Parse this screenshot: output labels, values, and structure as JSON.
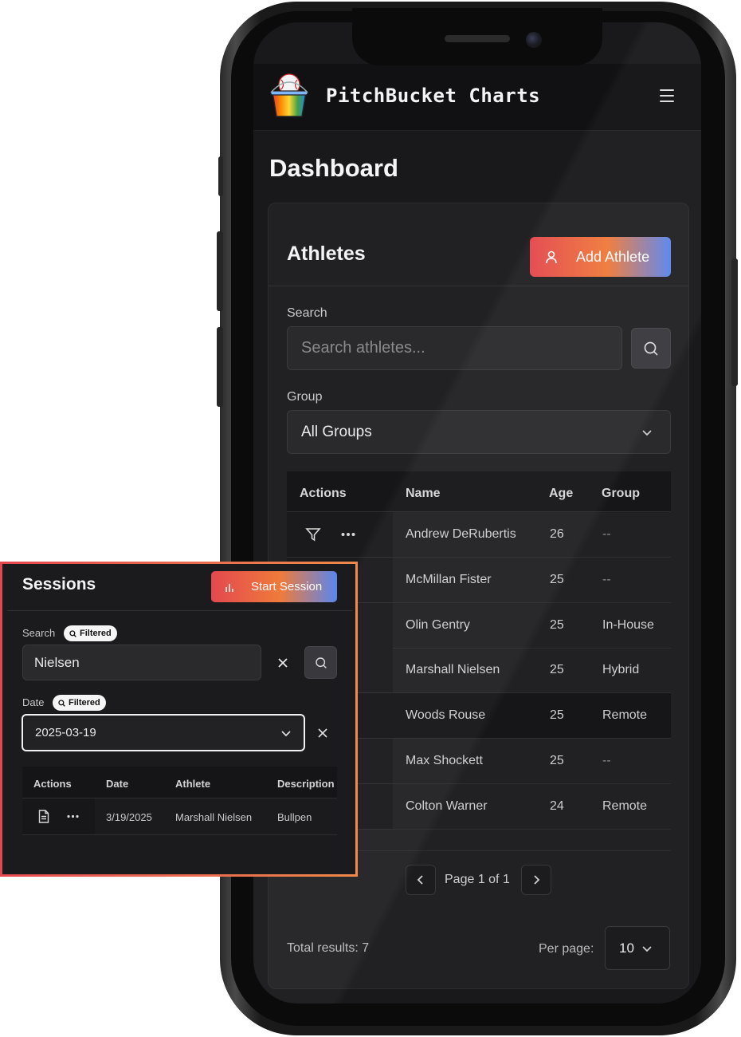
{
  "app": {
    "title": "PitchBucket Charts"
  },
  "page": {
    "title": "Dashboard"
  },
  "athletes": {
    "title": "Athletes",
    "add_button": "Add Athlete",
    "search_label": "Search",
    "search_placeholder": "Search athletes...",
    "group_label": "Group",
    "group_value": "All Groups",
    "columns": [
      "Actions",
      "Name",
      "Age",
      "Group"
    ],
    "rows": [
      {
        "name": "Andrew DeRubertis",
        "age": "26",
        "group": "--"
      },
      {
        "name": "McMillan Fister",
        "age": "25",
        "group": "--"
      },
      {
        "name": "Olin Gentry",
        "age": "25",
        "group": "In-House"
      },
      {
        "name": "Marshall Nielsen",
        "age": "25",
        "group": "Hybrid"
      },
      {
        "name": "Woods Rouse",
        "age": "25",
        "group": "Remote"
      },
      {
        "name": "Max Shockett",
        "age": "25",
        "group": "--"
      },
      {
        "name": "Colton Warner",
        "age": "24",
        "group": "Remote"
      }
    ],
    "pagination": {
      "text": "Page 1 of 1"
    },
    "total_results": "Total results: 7",
    "per_page_label": "Per page:",
    "per_page_value": "10"
  },
  "sessions": {
    "title": "Sessions",
    "start_button": "Start Session",
    "search_label": "Search",
    "filtered_badge": "Filtered",
    "search_value": "Nielsen",
    "date_label": "Date",
    "date_value": "2025-03-19",
    "columns": [
      "Actions",
      "Date",
      "Athlete",
      "Description"
    ],
    "rows": [
      {
        "date": "3/19/2025",
        "athlete": "Marshall Nielsen",
        "description": "Bullpen"
      }
    ]
  },
  "icons": {
    "menu": "hamburger-menu-icon",
    "search": "search-icon",
    "chevron": "chevron-down-icon",
    "filter": "filter-icon",
    "more": "more-horizontal-icon",
    "user": "user-icon",
    "chart": "bar-chart-icon",
    "document": "document-icon",
    "close": "close-icon"
  },
  "colors": {
    "gradient_start": "#e4484f",
    "gradient_mid": "#ef7b3b",
    "gradient_end": "#5a86ef"
  }
}
